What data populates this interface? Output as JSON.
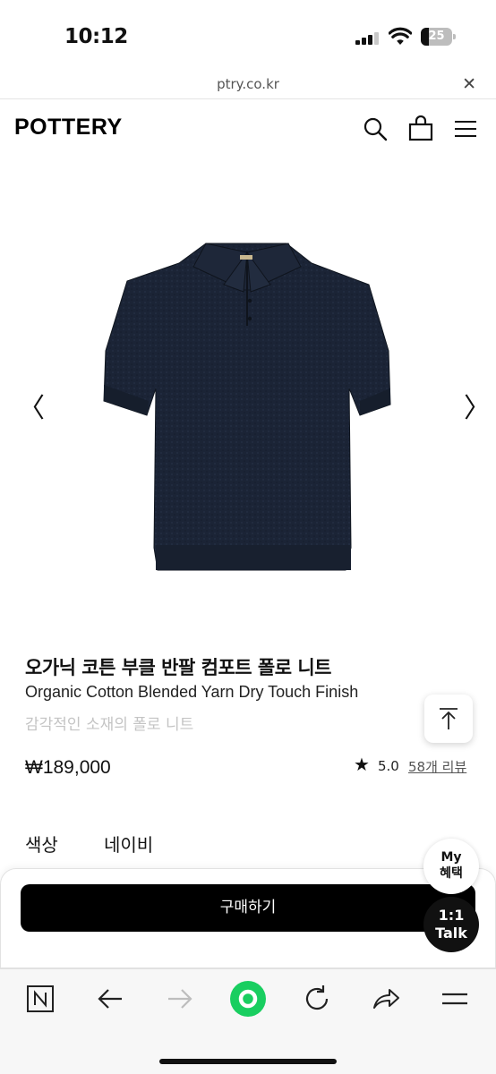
{
  "status_bar": {
    "time": "10:12",
    "battery_level": "25",
    "battery_fraction": 0.25
  },
  "browser": {
    "url": "ptry.co.kr",
    "close_icon": "close-icon",
    "close_label": "✕"
  },
  "header": {
    "logo": "POTTERY",
    "icons": [
      "search-icon",
      "bag-icon",
      "menu-icon"
    ]
  },
  "gallery": {
    "prev_label": "〈",
    "next_label": "〉",
    "image_icon": "navy-polo-knit-image"
  },
  "product": {
    "title": "오가닉 코튼 부클 반팔 컴포트 폴로 니트",
    "subtitle": "Organic Cotton Blended Yarn Dry Touch Finish",
    "tagline": "감각적인 소재의 폴로 니트",
    "price": "₩189,000",
    "rating_star": "★",
    "rating": "5.0",
    "reviews": "58개 리뷰",
    "rating_fraction": 1.0
  },
  "options": {
    "color_label": "색상",
    "color_value": "네이비"
  },
  "actions": {
    "buy_label": "구매하기",
    "my_benefit": [
      "My",
      "혜택"
    ],
    "talk": [
      "1:1",
      "Talk"
    ],
    "scroll_top_icon": "arrow-up-to-line-icon"
  },
  "toolbar": {
    "icons": [
      "naver-n-icon",
      "back-arrow-icon",
      "forward-arrow-icon",
      "green-dot-icon",
      "reload-icon",
      "share-icon",
      "menu-icon"
    ],
    "forward_disabled": true
  },
  "colors": {
    "accent_green": "#19ce60",
    "black": "#000000",
    "muted_text": "#c4c4c4",
    "navy": "#1a2233"
  }
}
